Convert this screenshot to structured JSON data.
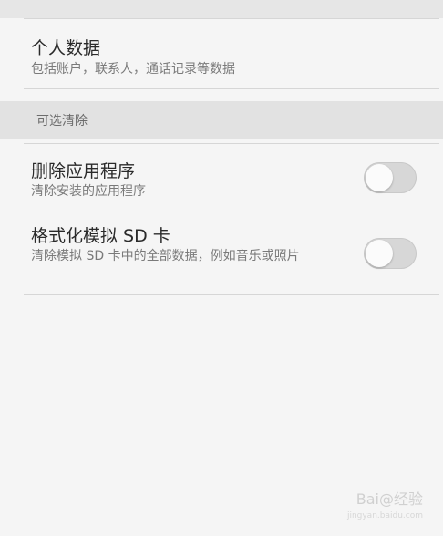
{
  "personal_data": {
    "title": "个人数据",
    "subtitle": "包括账户，联系人，通话记录等数据"
  },
  "section": {
    "label": "可选清除"
  },
  "options": [
    {
      "title": "删除应用程序",
      "subtitle": "清除安装的应用程序",
      "enabled": false
    },
    {
      "title": "格式化模拟 SD 卡",
      "subtitle": "清除模拟 SD 卡中的全部数据，例如音乐或照片",
      "enabled": false
    }
  ],
  "watermark": {
    "text": "Bai@经验",
    "url": "jingyan.baidu.com"
  },
  "colors": {
    "toggle_off": "#d7d7d7",
    "knob": "#fbfbfb",
    "section_bg": "#e2e2e2"
  }
}
